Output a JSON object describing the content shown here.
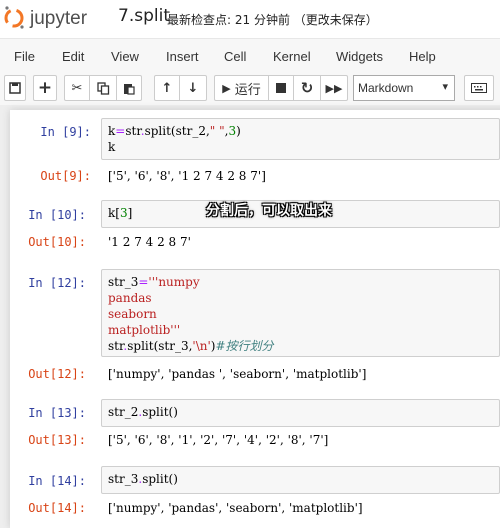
{
  "header": {
    "logo_text": "jupyter",
    "notebook_title": "7.split",
    "checkpoint": "最新检查点: 21 分钟前 （更改未保存）"
  },
  "menu": [
    "File",
    "Edit",
    "View",
    "Insert",
    "Cell",
    "Kernel",
    "Widgets",
    "Help"
  ],
  "toolbar": {
    "run_label": "运行",
    "cell_type": "Markdown"
  },
  "cells": [
    {
      "in_prompt": "In  [9]:",
      "out_prompt": "Out[9]:",
      "output": "['5', '6', '8', '1 2 7 4 2 8 7']"
    },
    {
      "in_prompt": "In  [10]:",
      "out_prompt": "Out[10]:",
      "output": "'1 2 7 4 2 8 7'"
    },
    {
      "in_prompt": "In  [12]:",
      "out_prompt": "Out[12]:",
      "output": "['numpy', 'pandas ', 'seaborn', 'matplotlib']"
    },
    {
      "in_prompt": "In  [13]:",
      "out_prompt": "Out[13]:",
      "output": "['5', '6', '8', '1', '2', '7', '4', '2', '8', '7']"
    },
    {
      "in_prompt": "In  [14]:",
      "out_prompt": "Out[14]:",
      "output": "['numpy', 'pandas', 'seaborn', 'matplotlib']"
    }
  ],
  "overlay_caption": "分割后，可以取出来",
  "colors": {
    "in_prompt": "#303f9f",
    "out_prompt": "#d84315",
    "logo_orange": "#f37726"
  }
}
